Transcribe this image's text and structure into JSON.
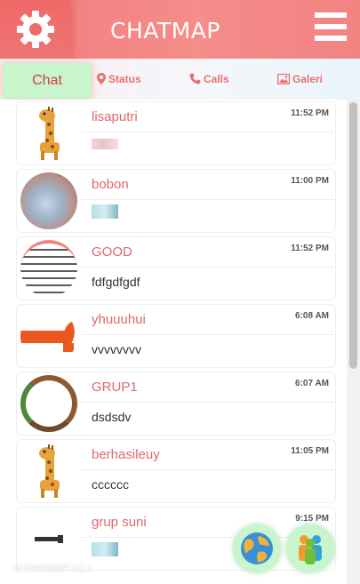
{
  "header": {
    "title": "CHATMAP",
    "settings_icon": "gear-icon",
    "menu_icon": "hamburger-icon",
    "colors": {
      "header_bg": "#f27d7d",
      "gear_bg": "#f06868",
      "accent": "#e0686a"
    }
  },
  "tabs": [
    {
      "label": "Chat",
      "icon": "",
      "active": true
    },
    {
      "label": "Status",
      "icon": "location-pin-icon"
    },
    {
      "label": "Calls",
      "icon": "phone-icon"
    },
    {
      "label": "Galeri",
      "icon": "image-icon"
    }
  ],
  "chats": [
    {
      "name": "lisaputri",
      "time": "11:52 PM",
      "message": "",
      "message_type": "image",
      "avatar": "giraffe"
    },
    {
      "name": "bobon",
      "time": "11:00 PM",
      "message": "",
      "message_type": "image",
      "avatar": "baby-photo"
    },
    {
      "name": "GOOD",
      "time": "11:52 PM",
      "message": "fdfgdfgdf",
      "message_type": "text",
      "avatar": "list-photo"
    },
    {
      "name": "yhuuuhui",
      "time": "6:08 AM",
      "message": "vvvvvvvv",
      "message_type": "text",
      "avatar": "kyucin-logo"
    },
    {
      "name": "GRUP1",
      "time": "6:07 AM",
      "message": "dsdsdv",
      "message_type": "text",
      "avatar": "frame-photo"
    },
    {
      "name": "berhasileuy",
      "time": "11:05 PM",
      "message": "cccccc",
      "message_type": "text",
      "avatar": "giraffe"
    },
    {
      "name": "grup suni",
      "time": "9:15 PM",
      "message": "",
      "message_type": "image",
      "avatar": "kyucin-small"
    }
  ],
  "fabs": {
    "globe_icon": "globe-icon",
    "people_icon": "people-icon"
  },
  "footer": {
    "text": "# CHATMAP v.1.1"
  }
}
